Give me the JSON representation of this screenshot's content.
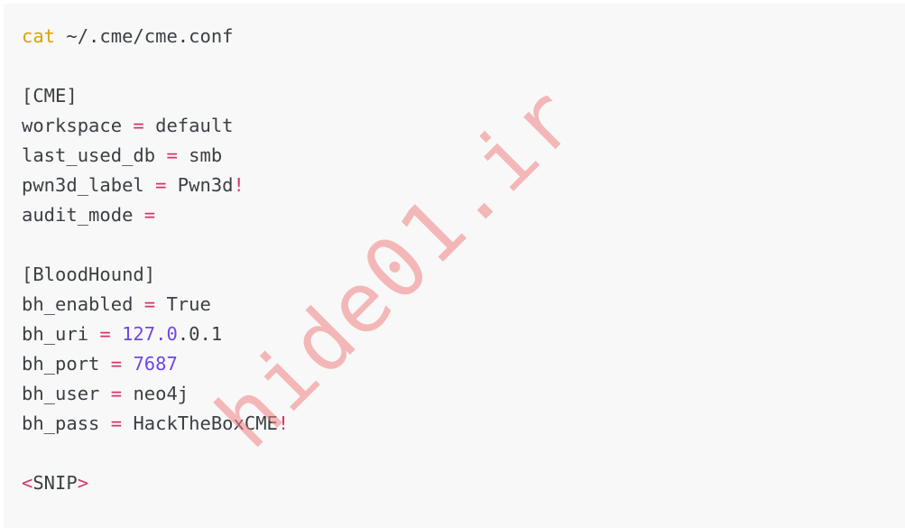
{
  "code": {
    "command": {
      "cmd": "cat",
      "arg": " ~/.cme/cme.conf"
    },
    "cme_header": "[CME]",
    "workspace": {
      "key": "workspace",
      "eq": " = ",
      "value": "default"
    },
    "last_used_db": {
      "key": "last_used_db",
      "eq": " = ",
      "value": "smb"
    },
    "pwn3d_label": {
      "key": "pwn3d_label",
      "eq": " = ",
      "value": "Pwn3d",
      "bang": "!"
    },
    "audit_mode": {
      "key": "audit_mode",
      "eq": " ="
    },
    "bloodhound_header": "[BloodHound]",
    "bh_enabled": {
      "key": "bh_enabled",
      "eq": " = ",
      "value": "True"
    },
    "bh_uri": {
      "key": "bh_uri",
      "eq": " = ",
      "num": "127.0",
      "rest": ".0.1"
    },
    "bh_port": {
      "key": "bh_port",
      "eq": " = ",
      "num": "7687"
    },
    "bh_user": {
      "key": "bh_user",
      "eq": " = ",
      "value": "neo4j"
    },
    "bh_pass": {
      "key": "bh_pass",
      "eq": " = ",
      "value": "HackTheBoxCME",
      "bang": "!"
    },
    "snip": {
      "lt": "<",
      "text": "SNIP",
      "gt": ">"
    }
  },
  "watermark": "hide01.ir",
  "colors": {
    "background": "#f8f8f8",
    "text": "#3b3f45",
    "command": "#d9a400",
    "operator": "#d6336c",
    "number": "#7048e8",
    "watermark": "#f08282"
  }
}
